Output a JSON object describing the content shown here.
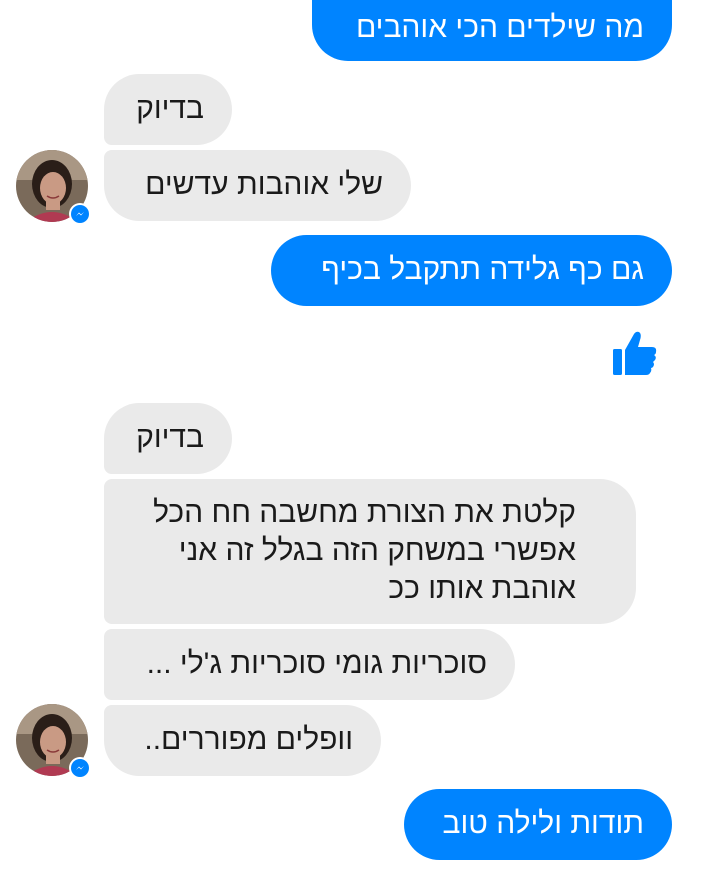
{
  "conversation": {
    "messages": [
      {
        "id": "m1",
        "sender": "me",
        "text": "מה שילדים הכי אוהבים"
      },
      {
        "id": "m2",
        "sender": "contact",
        "text": "בדיוק"
      },
      {
        "id": "m3",
        "sender": "contact",
        "text": "שלי אוהבות עדשים"
      },
      {
        "id": "m4",
        "sender": "me",
        "text": "גם כף גלידה תתקבל בכיף"
      },
      {
        "id": "m5",
        "sender": "me",
        "type": "like-sticker"
      },
      {
        "id": "m6",
        "sender": "contact",
        "text": "בדיוק"
      },
      {
        "id": "m7",
        "sender": "contact",
        "lines": [
          "קלטת את הצורת מחשבה חח הכל",
          "אפשרי במשחק הזה בגלל זה אני",
          "אוהבת אותו ככ"
        ]
      },
      {
        "id": "m8",
        "sender": "contact",
        "text": "סוכריות גומי סוכריות ג'לי ..."
      },
      {
        "id": "m9",
        "sender": "contact",
        "text": "וופלים מפוררים.."
      },
      {
        "id": "m10",
        "sender": "me",
        "text": "תודות ולילה טוב"
      }
    ]
  },
  "colors": {
    "sent_bubble": "#0084ff",
    "received_bubble": "#eaeaea",
    "background": "#ffffff"
  },
  "icons": {
    "like": "thumbs-up-icon",
    "avatar_badge": "messenger-icon"
  }
}
